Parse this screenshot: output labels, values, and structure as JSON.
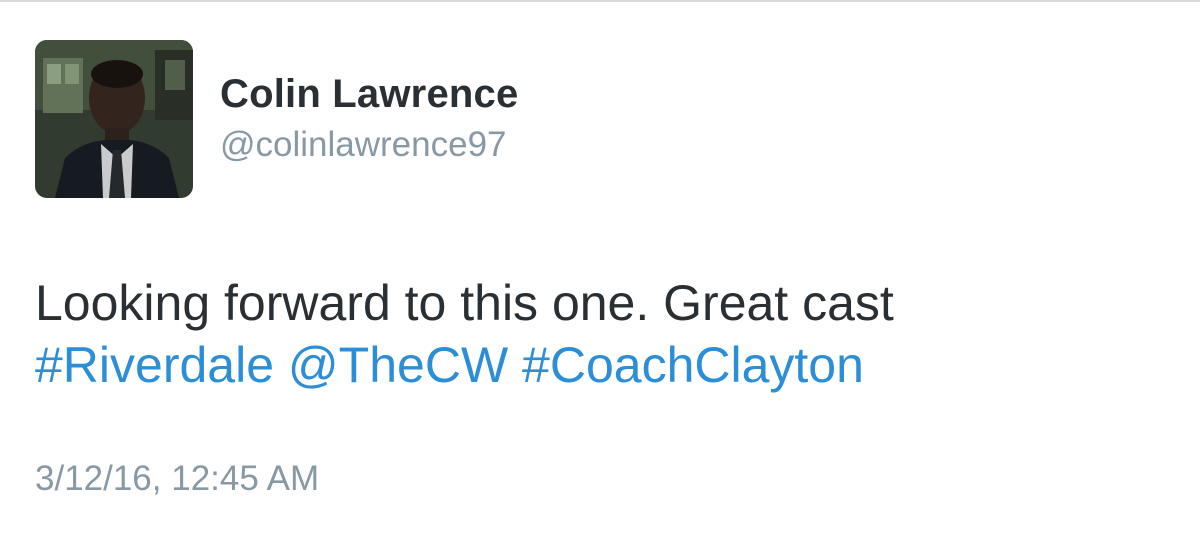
{
  "author": {
    "display_name": "Colin Lawrence",
    "handle": "@colinlawrence97",
    "avatar_icon": "profile-photo"
  },
  "tweet": {
    "text_line1": "Looking forward to this one. Great cast",
    "links": [
      {
        "type": "hashtag",
        "text": "#Riverdale"
      },
      {
        "type": "mention",
        "text": "@TheCW"
      },
      {
        "type": "hashtag",
        "text": "#CoachClayton"
      }
    ],
    "timestamp": "3/12/16, 12:45 AM"
  },
  "colors": {
    "text": "#292f33",
    "secondary": "#8899a6",
    "link": "#2b8ed6",
    "background": "#ffffff"
  }
}
